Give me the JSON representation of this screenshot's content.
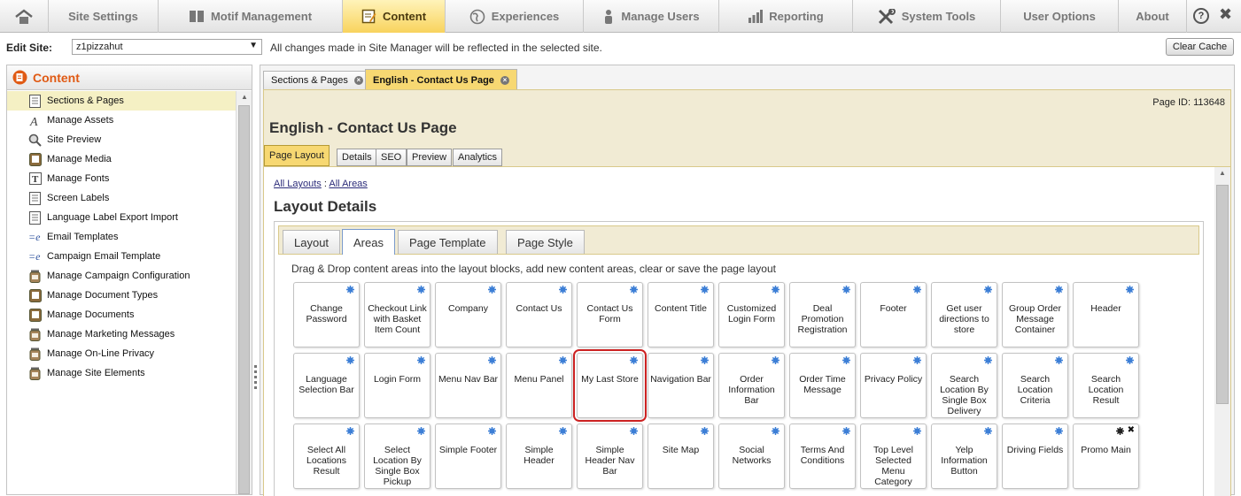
{
  "topnav": {
    "items": [
      {
        "label": "",
        "icon": "home-icon"
      },
      {
        "label": "Site Settings"
      },
      {
        "label": "Motif Management",
        "icon": "book-icon"
      },
      {
        "label": "Content",
        "icon": "document-edit-icon",
        "active": true
      },
      {
        "label": "Experiences",
        "icon": "globe-icon"
      },
      {
        "label": "Manage Users",
        "icon": "users-icon"
      },
      {
        "label": "Reporting",
        "icon": "bar-chart-icon"
      },
      {
        "label": "System Tools",
        "icon": "tools-icon"
      },
      {
        "label": "User Options"
      },
      {
        "label": "About"
      }
    ],
    "help_label": "?",
    "close_label": "✖"
  },
  "sitebar": {
    "label": "Edit Site:",
    "site_value": "z1pizzahut",
    "message": "All changes made in Site Manager will be reflected in the selected site.",
    "clear_cache_label": "Clear Cache"
  },
  "sidebar": {
    "title": "Content",
    "items": [
      {
        "label": "Sections & Pages",
        "icon": "page-icon",
        "selected": true
      },
      {
        "label": "Manage Assets",
        "icon": "font-a-icon"
      },
      {
        "label": "Site Preview",
        "icon": "magnifier-icon"
      },
      {
        "label": "Manage Media",
        "icon": "media-icon"
      },
      {
        "label": "Manage Fonts",
        "icon": "font-t-icon"
      },
      {
        "label": "Screen Labels",
        "icon": "page-icon"
      },
      {
        "label": "Language Label Export Import",
        "icon": "page-icon"
      },
      {
        "label": "Email Templates",
        "icon": "email-icon"
      },
      {
        "label": "Campaign Email Template",
        "icon": "email-icon"
      },
      {
        "label": "Manage Campaign Configuration",
        "icon": "jar-icon"
      },
      {
        "label": "Manage Document Types",
        "icon": "media-icon"
      },
      {
        "label": "Manage Documents",
        "icon": "media-icon"
      },
      {
        "label": "Manage Marketing Messages",
        "icon": "jar-icon"
      },
      {
        "label": "Manage On-Line Privacy",
        "icon": "jar-icon"
      },
      {
        "label": "Manage Site Elements",
        "icon": "jar-icon"
      }
    ]
  },
  "main": {
    "tabs": [
      {
        "label": "Sections & Pages"
      },
      {
        "label": "English - Contact Us Page",
        "active": true
      }
    ],
    "page_id": "Page ID: 113648",
    "page_title": "English - Contact Us Page",
    "inner_tabs": [
      {
        "label": "Page Layout",
        "active": true
      },
      {
        "label": "Details"
      },
      {
        "label": "SEO"
      },
      {
        "label": "Preview"
      },
      {
        "label": "Analytics"
      }
    ],
    "breadcrumb": {
      "link1": "All Layouts",
      "sep": ":",
      "link2": "All Areas"
    },
    "layout_title": "Layout Details",
    "area_tabs": [
      {
        "label": "Layout"
      },
      {
        "label": "Areas",
        "active": true
      },
      {
        "label": "Page Template"
      },
      {
        "label": "Page Style"
      }
    ],
    "instructions": "Drag & Drop content areas into the layout blocks, add new content areas, clear or save the page layout",
    "blocks": [
      "Change Password",
      "Checkout Link with Basket Item Count",
      "Company",
      "Contact Us",
      "Contact Us Form",
      "Content Title",
      "Customized Login Form",
      "Deal Promotion Registration",
      "Footer",
      "Get user directions to store",
      "Group Order Message Container",
      "Header",
      "Language Selection Bar",
      "Login Form",
      "Menu Nav Bar",
      "Menu Panel",
      "My Last Store",
      "Navigation Bar",
      "Order Information Bar",
      "Order Time Message",
      "Privacy Policy",
      "Search Location By Single Box Delivery Address",
      "Search Location Criteria",
      "Search Location Result",
      "Select All Locations Result",
      "Select Location By Single Box Pickup Address",
      "Simple Footer",
      "Simple Header",
      "Simple Header Nav Bar",
      "Site Map",
      "Social Networks",
      "Terms And Conditions",
      "Top Level Selected Menu Category",
      "Yelp Information Button",
      "Driving Fields",
      "Promo Main"
    ],
    "selected_block": "My Last Store",
    "delete_block": "Promo Main",
    "delete_label": "✖",
    "colors": {
      "accent": "#f7d872",
      "brand_orange": "#e05a14",
      "gear_blue": "#3d7fd6",
      "selection_red": "#cc2222"
    }
  }
}
